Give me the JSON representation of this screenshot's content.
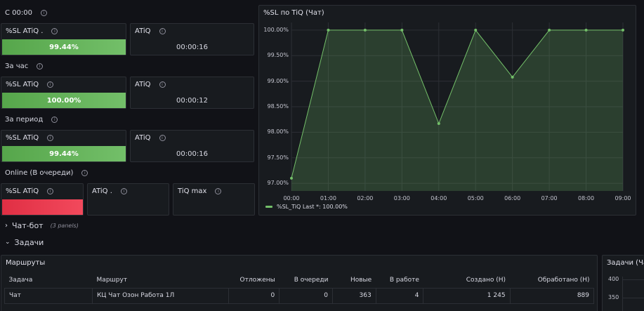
{
  "sections": {
    "since_midnight": "С 00:00",
    "last_hour": "За час",
    "period": "За период",
    "online": "Online (В очереди)"
  },
  "stats": {
    "r1_sl_title": "%SL ATiQ .",
    "r1_sl_value": "99.44%",
    "r1_atiq_title": "ATiQ",
    "r1_atiq_value": "00:00:16",
    "r2_sl_title": "%SL ATiQ",
    "r2_sl_value": "100.00%",
    "r2_atiq_title": "ATiQ",
    "r2_atiq_value": "00:00:12",
    "r3_sl_title": "%SL ATiQ",
    "r3_sl_value": "99.44%",
    "r3_atiq_title": "ATiQ",
    "r3_atiq_value": "00:00:16",
    "online_sl_title": "%SL ATiQ",
    "online_atiq_title": "ATiQ .",
    "online_tiqmax_title": "TiQ max"
  },
  "colors": {
    "green": "#73bf69",
    "red": "#f2495c",
    "background": "#111217",
    "panel": "#181b1f"
  },
  "rows": {
    "chatbot": "Чат-бот",
    "chatbot_count": "(3 panels)",
    "tasks": "Задачи"
  },
  "routes": {
    "title": "Маршруты",
    "columns": [
      "Задача",
      "Маршрут",
      "Отложены",
      "В очереди",
      "Новые",
      "В работе",
      "Создано (Н)",
      "Обработано (Н)"
    ],
    "rows": [
      [
        "Чат",
        "КЦ Чат Озон Работа 1Л",
        "0",
        "0",
        "363",
        "4",
        "1 245",
        "889"
      ]
    ]
  },
  "tasks_panel": {
    "title": "Задачи (Чат",
    "y_labels": [
      "400",
      "350"
    ]
  },
  "chart_data": {
    "type": "area",
    "title": "%SL по TiQ (Чат)",
    "x": [
      "00:00",
      "01:00",
      "02:00",
      "03:00",
      "04:00",
      "05:00",
      "06:00",
      "07:00",
      "08:00",
      "09:00"
    ],
    "x_ticks": [
      "00:00",
      "01:00",
      "02:00",
      "03:00",
      "04:00",
      "05:00",
      "06:00",
      "07:00",
      "08:00",
      "09:00"
    ],
    "y_ticks": [
      "97.00%",
      "97.50%",
      "98.00%",
      "98.50%",
      "99.00%",
      "99.50%",
      "100.00%"
    ],
    "ylim": [
      96.85,
      100.15
    ],
    "grid": true,
    "legend_position": "bottom-left",
    "series": [
      {
        "name": "%SL_TiQ",
        "color": "#73bf69",
        "values": [
          97.1,
          100.0,
          100.0,
          100.0,
          98.17,
          100.0,
          99.08,
          100.0,
          100.0,
          100.0
        ]
      }
    ],
    "legend_text": "%SL_TiQ  Last *: 100.00%"
  }
}
